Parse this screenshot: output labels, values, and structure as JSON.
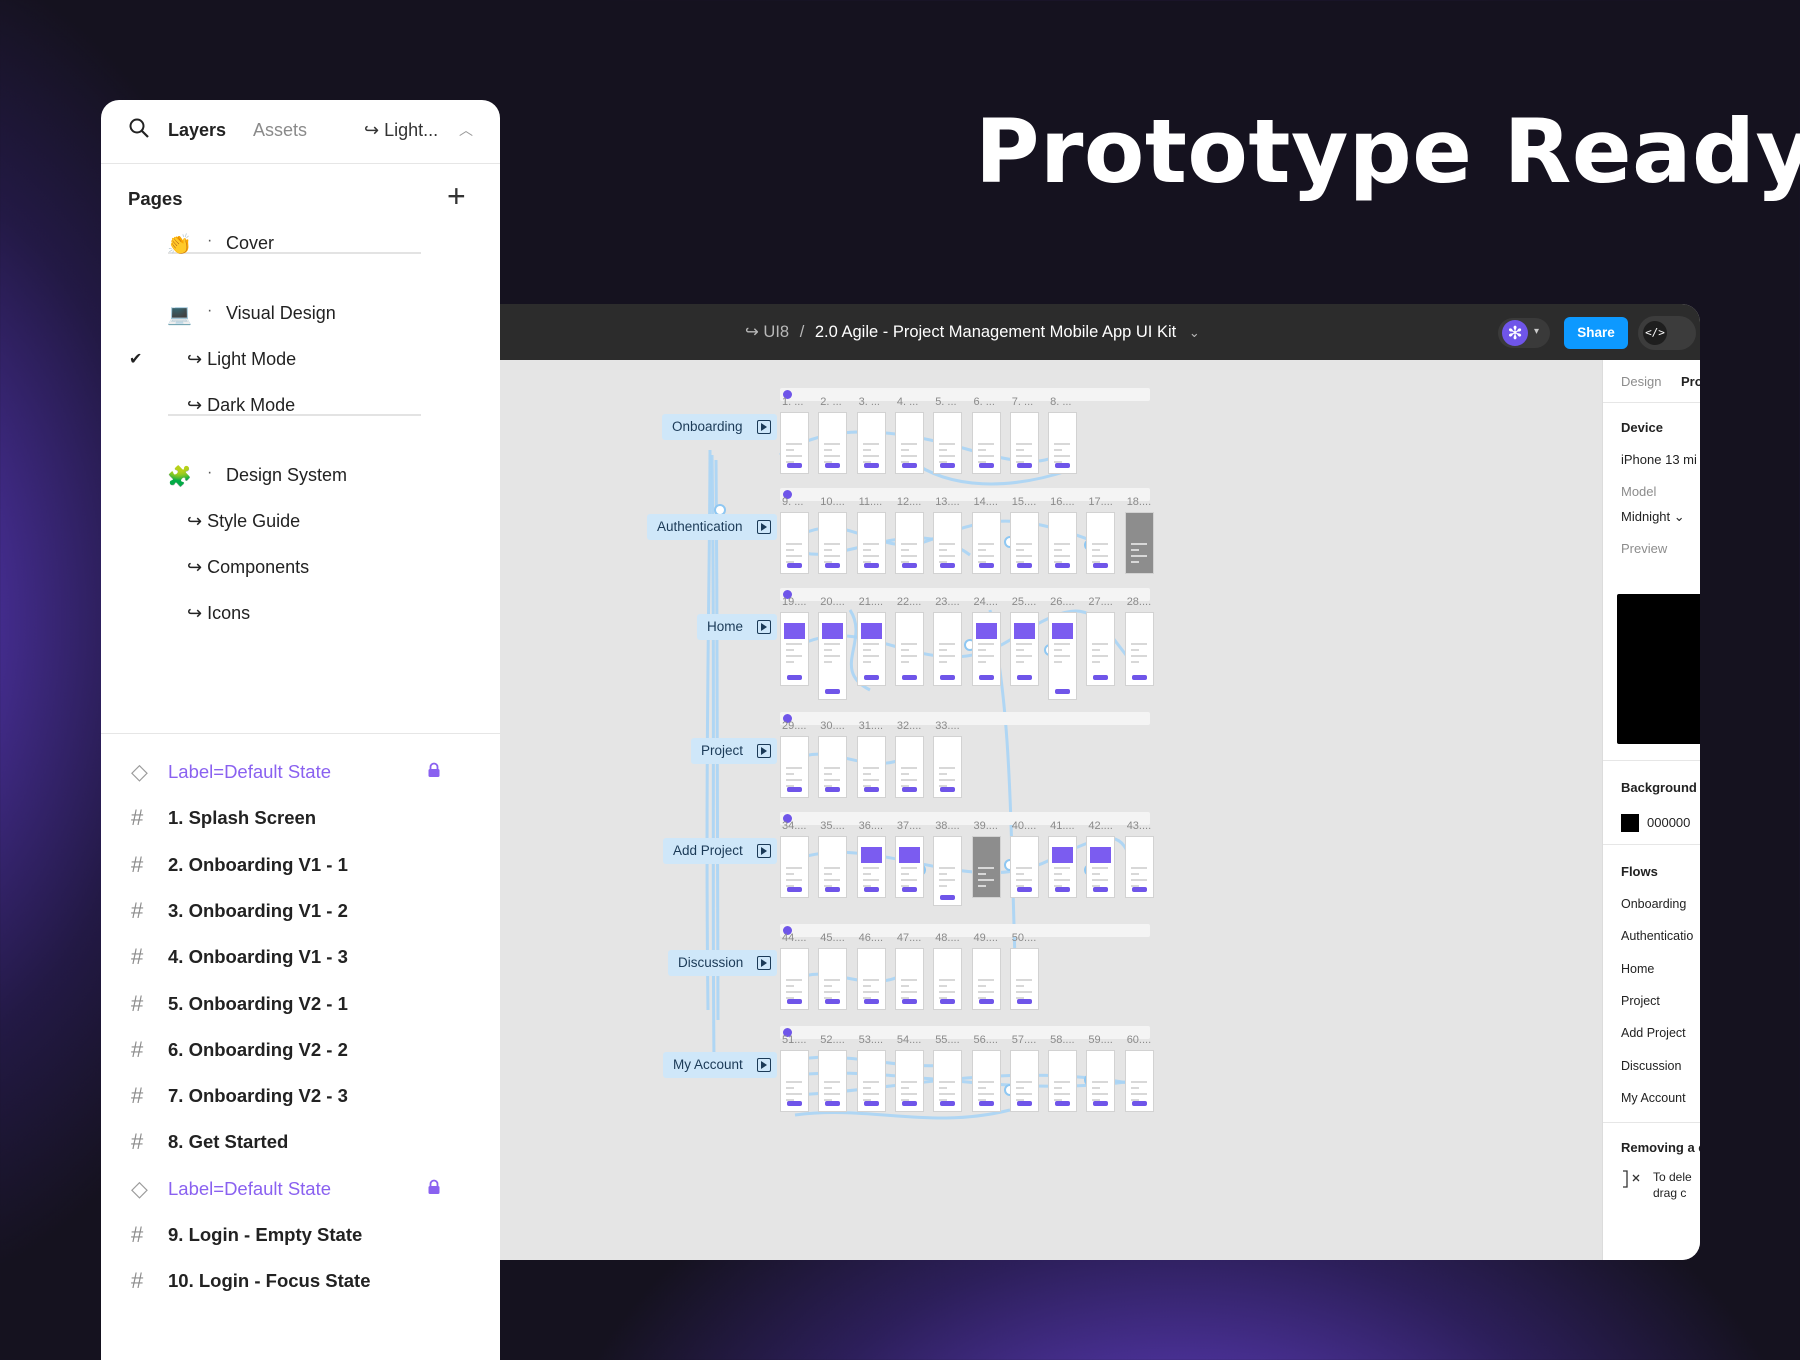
{
  "headline": "Prototype Ready",
  "layers_panel": {
    "tabs": [
      "Layers",
      "Assets"
    ],
    "active_tab": "Layers",
    "page_selector": "↪ Light...",
    "pages_heading": "Pages",
    "pages": [
      {
        "emoji": "👏",
        "label": "Cover",
        "dot": "·",
        "indent": false
      },
      {
        "emoji": "💻",
        "label": "Visual Design",
        "dot": "·",
        "indent": false
      },
      {
        "label": "↪ Light Mode",
        "indent": true,
        "checked": true
      },
      {
        "label": "↪ Dark Mode",
        "indent": true
      },
      {
        "emoji": "🧩",
        "label": "Design System",
        "dot": "·",
        "indent": false
      },
      {
        "label": "↪ Style Guide",
        "indent": true
      },
      {
        "label": "↪ Components",
        "indent": true
      },
      {
        "label": "↪ Icons",
        "indent": true
      }
    ],
    "layers": [
      {
        "type": "component",
        "label": "Label=Default State",
        "locked": true
      },
      {
        "type": "frame",
        "label": "1. Splash Screen"
      },
      {
        "type": "frame",
        "label": "2. Onboarding V1 - 1"
      },
      {
        "type": "frame",
        "label": "3. Onboarding V1 - 2"
      },
      {
        "type": "frame",
        "label": "4. Onboarding V1 - 3"
      },
      {
        "type": "frame",
        "label": "5. Onboarding V2 - 1"
      },
      {
        "type": "frame",
        "label": "6. Onboarding V2 - 2"
      },
      {
        "type": "frame",
        "label": "7. Onboarding V2 - 3"
      },
      {
        "type": "frame",
        "label": "8. Get Started"
      },
      {
        "type": "component",
        "label": "Label=Default State",
        "locked": true
      },
      {
        "type": "frame",
        "label": "9. Login - Empty State"
      },
      {
        "type": "frame",
        "label": "10. Login - Focus State"
      }
    ]
  },
  "editor": {
    "breadcrumb_team": "↪ UI8",
    "breadcrumb_sep": "/",
    "file_name": "2.0 Agile - Project Management Mobile App UI Kit",
    "file_chevron": "⌄",
    "share_label": "Share",
    "code_label": "</>",
    "accent_color": "#6f55e9",
    "share_color": "#0d99ff",
    "flows_on_canvas": [
      {
        "label": "Onboarding",
        "frames": [
          "1. ...",
          "2. ...",
          "3. ...",
          "4. ...",
          "5. ...",
          "6. ...",
          "7. ...",
          "8. ..."
        ]
      },
      {
        "label": "Authentication",
        "frames": [
          "9. ...",
          "10....",
          "11....",
          "12....",
          "13....",
          "14....",
          "15....",
          "16....",
          "17....",
          "18...."
        ]
      },
      {
        "label": "Home",
        "frames": [
          "19....",
          "20....",
          "21....",
          "22....",
          "23....",
          "24....",
          "25....",
          "26....",
          "27....",
          "28...."
        ]
      },
      {
        "label": "Project",
        "frames": [
          "29....",
          "30....",
          "31....",
          "32....",
          "33...."
        ]
      },
      {
        "label": "Add Project",
        "frames": [
          "34....",
          "35....",
          "36....",
          "37....",
          "38....",
          "39....",
          "40....",
          "41....",
          "42....",
          "43...."
        ]
      },
      {
        "label": "Discussion",
        "frames": [
          "44....",
          "45....",
          "46....",
          "47....",
          "48....",
          "49....",
          "50...."
        ]
      },
      {
        "label": "My Account",
        "frames": [
          "51....",
          "52....",
          "53....",
          "54....",
          "55....",
          "56....",
          "57....",
          "58....",
          "59....",
          "60...."
        ]
      }
    ],
    "right_panel": {
      "tabs": [
        "Design",
        "Pro"
      ],
      "device_heading": "Device",
      "device_value": "iPhone 13 mi",
      "model_label": "Model",
      "model_value": "Midnight ⌄",
      "preview_label": "Preview",
      "background_heading": "Background",
      "background_value": "000000",
      "flows_heading": "Flows",
      "flows": [
        "Onboarding",
        "Authenticatio",
        "Home",
        "Project",
        "Add Project",
        "Discussion",
        "My Account"
      ],
      "removing_heading": "Removing a c",
      "removing_text_1": "To dele",
      "removing_text_2": "drag c"
    }
  }
}
